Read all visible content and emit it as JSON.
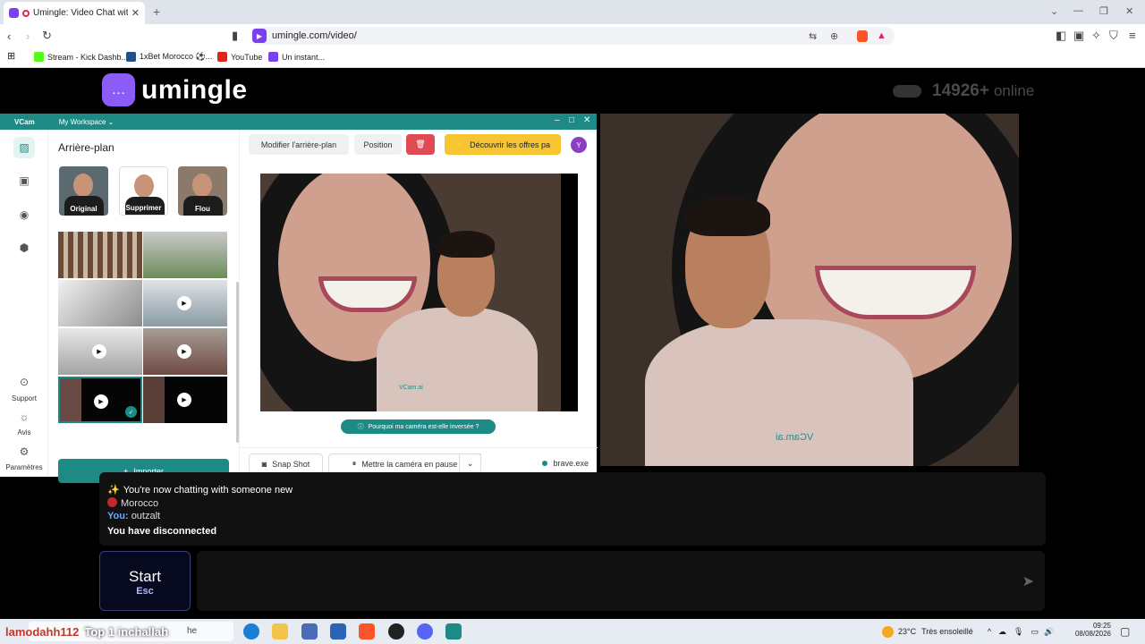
{
  "browser": {
    "tab_title": "Umingle: Video Chat with Str",
    "tab_close": "✕",
    "new_tab": "+",
    "url": "umingle.com/video/",
    "bookmarks": [
      {
        "label": "Stream - Kick Dashb...",
        "color": "#1c1c1c"
      },
      {
        "label": "1xBet Morocco ⚽...",
        "color": "#1d4f91"
      },
      {
        "label": "YouTube",
        "color": "#e62117"
      },
      {
        "label": "Un instant...",
        "color": "#7b3ff2"
      }
    ]
  },
  "site": {
    "logo_text": "umingle",
    "online_count": "14926+",
    "online_label": "online"
  },
  "vcam": {
    "app_name": "VCam",
    "workspace": "My Workspace",
    "sidebar_bottom": [
      {
        "label": "Support",
        "icon": "help-icon"
      },
      {
        "label": "Avis",
        "icon": "lightbulb-icon"
      },
      {
        "label": "Paramètres",
        "icon": "gear-icon"
      }
    ],
    "panel_title": "Arrière-plan",
    "options": [
      "Original",
      "Supprimer",
      "Flou"
    ],
    "import_label": "Importer",
    "toolbar": {
      "modify": "Modifier l'arrière-plan",
      "position": "Position",
      "offers": "Découvrir les offres pa",
      "avatar": "Y"
    },
    "watermark": "VCam.ai",
    "why_inverted": "Pourquoi ma caméra est-elle inversée ?",
    "snapshot": "Snap Shot",
    "pause": "Mettre la caméra en pause",
    "source": "brave.exe"
  },
  "remote": {
    "watermark": "VCam.ai"
  },
  "chat": {
    "line1": "You're now chatting with someone new",
    "country": "Morocco",
    "you_label": "You:",
    "you_message": "outzalt",
    "disconnected": "You have disconnected"
  },
  "controls": {
    "start": "Start",
    "start_key": "Esc"
  },
  "taskbar": {
    "overlay_name": "lamodahh112",
    "overlay_text": "Top 1 inchallah",
    "overlay_under": "he",
    "weather_temp": "23°C",
    "weather_desc": "Très ensoleillé",
    "time": "09:25",
    "date": "08/08/2026"
  }
}
